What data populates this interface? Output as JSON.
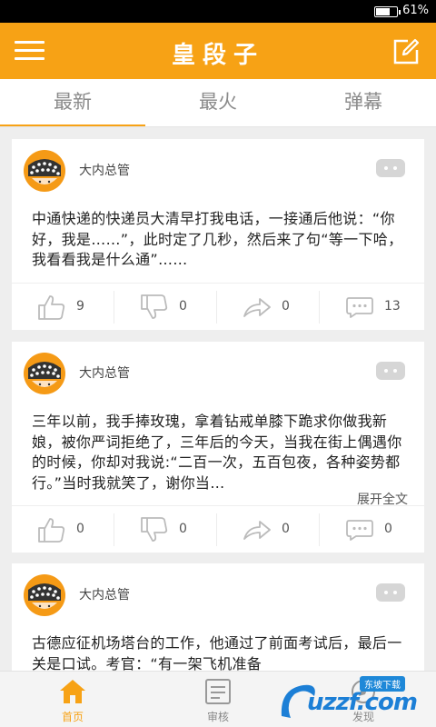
{
  "status_bar": {
    "battery_level": 0.61,
    "battery_text": "61%"
  },
  "app_bar": {
    "title": "皇段子",
    "menu_icon": "hamburger-menu-icon",
    "edit_icon": "compose-icon"
  },
  "tabs": [
    {
      "label": "最新",
      "active": true
    },
    {
      "label": "最火",
      "active": false
    },
    {
      "label": "弹幕",
      "active": false
    }
  ],
  "posts": [
    {
      "author": "大内总管",
      "text": "中通快递的快递员大清早打我电话，一接通后他说：“你好，我是……”，此时定了几秒，然后来了句“等一下哈，我看看我是什么通”……",
      "expand_label": "",
      "likes": "9",
      "dislikes": "0",
      "shares": "0",
      "comments": "13"
    },
    {
      "author": "大内总管",
      "text": "三年以前，我手捧玫瑰，拿着钻戒单膝下跪求你做我新娘，被你严词拒绝了，三年后的今天，当我在街上偶遇你的时候，你却对我说:“二百一次，五百包夜，各种姿势都行。”当时我就笑了，谢你当…",
      "expand_label": "展开全文",
      "likes": "0",
      "dislikes": "0",
      "shares": "0",
      "comments": "0"
    },
    {
      "author": "大内总管",
      "text": "古德应征机场塔台的工作，他通过了前面考试后，最后一关是口试。考官：“有一架飞机准备",
      "expand_label": "",
      "likes": "",
      "dislikes": "",
      "shares": "",
      "comments": ""
    }
  ],
  "bottom_nav": [
    {
      "label": "首页",
      "icon": "home-icon",
      "active": true
    },
    {
      "label": "审核",
      "icon": "review-icon",
      "active": false
    },
    {
      "label": "发现",
      "icon": "discover-icon",
      "active": false
    }
  ],
  "watermark": {
    "badge": "东坡下载",
    "text": "uzzf.com"
  },
  "colors": {
    "accent": "#f7a215",
    "text": "#222222",
    "muted": "#8a8a8a",
    "background": "#eeeeee"
  }
}
